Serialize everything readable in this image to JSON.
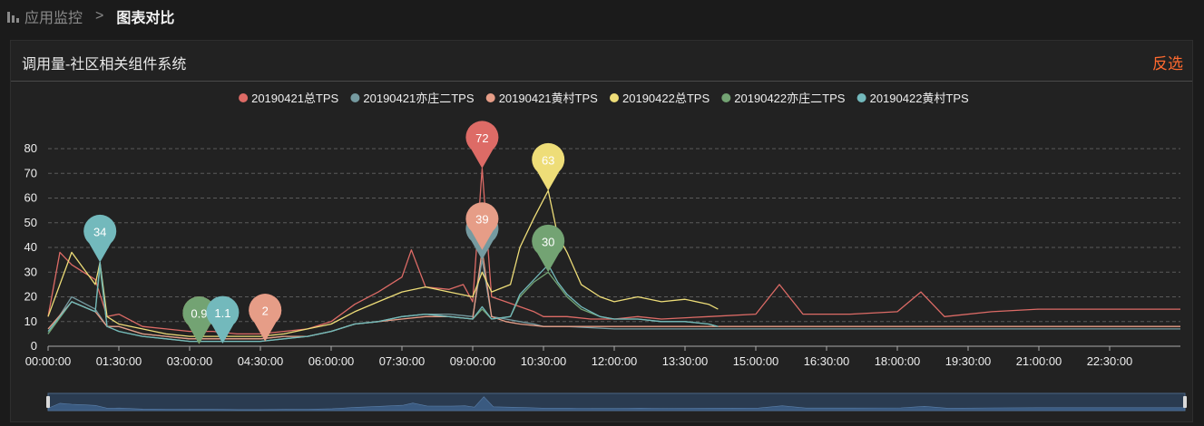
{
  "breadcrumb": {
    "parent": "应用监控",
    "separator": ">",
    "current": "图表对比"
  },
  "panel": {
    "title": "调用量-社区相关组件系统",
    "invert_label": "反选"
  },
  "chart_data": {
    "type": "line",
    "x_labels": [
      "00:00:00",
      "01:30:00",
      "03:00:00",
      "04:30:00",
      "06:00:00",
      "07:30:00",
      "09:00:00",
      "10:30:00",
      "12:00:00",
      "13:30:00",
      "15:00:00",
      "16:30:00",
      "18:00:00",
      "19:30:00",
      "21:00:00",
      "22:30:00"
    ],
    "x_range_hours": [
      0,
      24
    ],
    "y_ticks": [
      0,
      10,
      20,
      30,
      40,
      50,
      60,
      70,
      80
    ],
    "ylim": [
      0,
      80
    ],
    "grid": "horizontal-dashed",
    "legend_position": "top-center",
    "series": [
      {
        "name": "20190421总TPS",
        "color": "#dd6b66",
        "points": [
          [
            0,
            12
          ],
          [
            0.25,
            38
          ],
          [
            0.5,
            33
          ],
          [
            0.75,
            30
          ],
          [
            1,
            27
          ],
          [
            1.25,
            12
          ],
          [
            1.5,
            13
          ],
          [
            2,
            8
          ],
          [
            2.5,
            7
          ],
          [
            3,
            6
          ],
          [
            3.5,
            6
          ],
          [
            4,
            5
          ],
          [
            4.5,
            5
          ],
          [
            5,
            6
          ],
          [
            5.5,
            7
          ],
          [
            6,
            10
          ],
          [
            6.5,
            17
          ],
          [
            7,
            22
          ],
          [
            7.5,
            28
          ],
          [
            7.7,
            39
          ],
          [
            8,
            24
          ],
          [
            8.5,
            23
          ],
          [
            8.8,
            25
          ],
          [
            9,
            18
          ],
          [
            9.2,
            72
          ],
          [
            9.4,
            20
          ],
          [
            9.7,
            18
          ],
          [
            10,
            16
          ],
          [
            10.3,
            14
          ],
          [
            10.5,
            12
          ],
          [
            11,
            12
          ],
          [
            11.5,
            11
          ],
          [
            12,
            11
          ],
          [
            12.5,
            12
          ],
          [
            13,
            11
          ],
          [
            14,
            12
          ],
          [
            15,
            13
          ],
          [
            15.5,
            25
          ],
          [
            16,
            13
          ],
          [
            16.5,
            13
          ],
          [
            17,
            13
          ],
          [
            18,
            14
          ],
          [
            18.5,
            22
          ],
          [
            19,
            12
          ],
          [
            20,
            14
          ],
          [
            21,
            15
          ],
          [
            22,
            15
          ],
          [
            23,
            15
          ],
          [
            24,
            15
          ]
        ],
        "markers": [
          {
            "label": "72",
            "x": 9.2,
            "y": 72
          },
          {
            "label": "2",
            "x": 4.6,
            "y": 2
          }
        ]
      },
      {
        "name": "20190421亦庄二TPS",
        "color": "#759aa0",
        "points": [
          [
            0,
            5
          ],
          [
            0.5,
            20
          ],
          [
            1,
            15
          ],
          [
            1.25,
            8
          ],
          [
            1.5,
            8
          ],
          [
            2,
            5
          ],
          [
            2.5,
            4
          ],
          [
            3,
            3
          ],
          [
            3.5,
            3
          ],
          [
            4,
            3
          ],
          [
            4.5,
            3
          ],
          [
            5,
            4
          ],
          [
            5.5,
            4
          ],
          [
            6,
            6
          ],
          [
            6.5,
            9
          ],
          [
            7,
            10
          ],
          [
            7.5,
            12
          ],
          [
            8,
            13
          ],
          [
            8.5,
            13
          ],
          [
            9,
            12
          ],
          [
            9.2,
            35
          ],
          [
            9.4,
            12
          ],
          [
            9.7,
            11
          ],
          [
            10,
            10
          ],
          [
            10.3,
            9
          ],
          [
            10.5,
            8
          ],
          [
            11,
            8
          ],
          [
            12,
            7
          ],
          [
            13,
            7
          ],
          [
            14,
            7
          ],
          [
            15,
            7
          ],
          [
            16,
            7
          ],
          [
            17,
            7
          ],
          [
            18,
            7
          ],
          [
            19,
            7
          ],
          [
            20,
            7
          ],
          [
            21,
            7
          ],
          [
            22,
            7
          ],
          [
            23,
            7
          ],
          [
            24,
            7
          ]
        ],
        "markers": [
          {
            "label": "",
            "x": 9.2,
            "y": 35
          }
        ]
      },
      {
        "name": "20190421黄村TPS",
        "color": "#e69d87",
        "points": [
          [
            0,
            7
          ],
          [
            0.5,
            18
          ],
          [
            1,
            14
          ],
          [
            1.25,
            8
          ],
          [
            1.5,
            8
          ],
          [
            2,
            5
          ],
          [
            2.5,
            4
          ],
          [
            3,
            3
          ],
          [
            3.5,
            3
          ],
          [
            4,
            3
          ],
          [
            4.5,
            3
          ],
          [
            5,
            4
          ],
          [
            5.5,
            4
          ],
          [
            6,
            6
          ],
          [
            6.5,
            9
          ],
          [
            7,
            10
          ],
          [
            7.5,
            11
          ],
          [
            8,
            12
          ],
          [
            8.5,
            12
          ],
          [
            9,
            11
          ],
          [
            9.2,
            39
          ],
          [
            9.4,
            12
          ],
          [
            9.7,
            10
          ],
          [
            10,
            9
          ],
          [
            10.5,
            8
          ],
          [
            11,
            8
          ],
          [
            12,
            8
          ],
          [
            13,
            8
          ],
          [
            14,
            8
          ],
          [
            15,
            8
          ],
          [
            16,
            8
          ],
          [
            17,
            8
          ],
          [
            18,
            8
          ],
          [
            19,
            8
          ],
          [
            20,
            8
          ],
          [
            21,
            8
          ],
          [
            22,
            8
          ],
          [
            23,
            8
          ],
          [
            24,
            8
          ]
        ],
        "markers": [
          {
            "label": "39",
            "x": 9.2,
            "y": 39
          },
          {
            "label": "2",
            "x": 4.6,
            "y": 2
          }
        ]
      },
      {
        "name": "20190422总TPS",
        "color": "#eedd78",
        "points": [
          [
            0,
            12
          ],
          [
            0.5,
            38
          ],
          [
            1,
            25
          ],
          [
            1.1,
            34
          ],
          [
            1.25,
            12
          ],
          [
            1.5,
            9
          ],
          [
            2,
            7
          ],
          [
            2.5,
            5
          ],
          [
            3,
            4
          ],
          [
            3.5,
            4
          ],
          [
            4,
            4
          ],
          [
            4.5,
            4
          ],
          [
            5,
            5
          ],
          [
            5.5,
            7
          ],
          [
            6,
            9
          ],
          [
            6.5,
            14
          ],
          [
            7,
            18
          ],
          [
            7.5,
            22
          ],
          [
            8,
            24
          ],
          [
            8.5,
            22
          ],
          [
            9,
            20
          ],
          [
            9.2,
            30
          ],
          [
            9.4,
            22
          ],
          [
            9.8,
            25
          ],
          [
            10,
            40
          ],
          [
            10.3,
            52
          ],
          [
            10.6,
            63
          ],
          [
            10.8,
            45
          ],
          [
            11,
            38
          ],
          [
            11.3,
            25
          ],
          [
            11.7,
            20
          ],
          [
            12,
            18
          ],
          [
            12.5,
            20
          ],
          [
            13,
            18
          ],
          [
            13.5,
            19
          ],
          [
            14,
            17
          ],
          [
            14.2,
            15
          ]
        ],
        "markers": [
          {
            "label": "63",
            "x": 10.6,
            "y": 63
          },
          {
            "label": "0.9",
            "x": 3.2,
            "y": 0.9
          }
        ]
      },
      {
        "name": "20190422亦庄二TPS",
        "color": "#73a373",
        "points": [
          [
            0,
            5
          ],
          [
            0.5,
            18
          ],
          [
            1,
            14
          ],
          [
            1.1,
            32
          ],
          [
            1.25,
            8
          ],
          [
            1.5,
            6
          ],
          [
            2,
            4
          ],
          [
            2.5,
            3
          ],
          [
            3,
            2
          ],
          [
            3.5,
            2
          ],
          [
            4,
            2
          ],
          [
            4.5,
            2
          ],
          [
            5,
            3
          ],
          [
            5.5,
            4
          ],
          [
            6,
            6
          ],
          [
            6.5,
            9
          ],
          [
            7,
            10
          ],
          [
            7.5,
            12
          ],
          [
            8,
            13
          ],
          [
            8.5,
            12
          ],
          [
            9,
            11
          ],
          [
            9.2,
            15
          ],
          [
            9.4,
            11
          ],
          [
            9.8,
            12
          ],
          [
            10,
            20
          ],
          [
            10.3,
            26
          ],
          [
            10.6,
            30
          ],
          [
            10.8,
            25
          ],
          [
            11,
            20
          ],
          [
            11.3,
            15
          ],
          [
            11.7,
            12
          ],
          [
            12,
            11
          ],
          [
            12.5,
            11
          ],
          [
            13,
            10
          ],
          [
            13.5,
            10
          ],
          [
            14,
            9
          ],
          [
            14.2,
            8
          ]
        ],
        "markers": [
          {
            "label": "30",
            "x": 10.6,
            "y": 30
          },
          {
            "label": "0.9",
            "x": 3.2,
            "y": 0.9
          }
        ]
      },
      {
        "name": "20190422黄村TPS",
        "color": "#73b9bc",
        "points": [
          [
            0,
            6
          ],
          [
            0.5,
            18
          ],
          [
            1,
            14
          ],
          [
            1.1,
            34
          ],
          [
            1.25,
            8
          ],
          [
            1.5,
            6
          ],
          [
            2,
            4
          ],
          [
            2.5,
            3
          ],
          [
            3,
            2
          ],
          [
            3.5,
            2
          ],
          [
            4,
            2
          ],
          [
            4.5,
            2
          ],
          [
            5,
            3
          ],
          [
            5.5,
            4
          ],
          [
            6,
            6
          ],
          [
            6.5,
            9
          ],
          [
            7,
            10
          ],
          [
            7.5,
            12
          ],
          [
            8,
            13
          ],
          [
            8.5,
            12
          ],
          [
            9,
            11
          ],
          [
            9.2,
            16
          ],
          [
            9.4,
            11
          ],
          [
            9.8,
            12
          ],
          [
            10,
            21
          ],
          [
            10.3,
            27
          ],
          [
            10.6,
            33
          ],
          [
            10.8,
            26
          ],
          [
            11,
            21
          ],
          [
            11.3,
            16
          ],
          [
            11.7,
            12
          ],
          [
            12,
            11
          ],
          [
            12.5,
            11
          ],
          [
            13,
            10
          ],
          [
            13.5,
            10
          ],
          [
            14,
            9
          ],
          [
            14.2,
            8
          ]
        ],
        "markers": [
          {
            "label": "34",
            "x": 1.1,
            "y": 34
          },
          {
            "label": "1.1",
            "x": 3.7,
            "y": 1.1
          }
        ]
      }
    ]
  }
}
